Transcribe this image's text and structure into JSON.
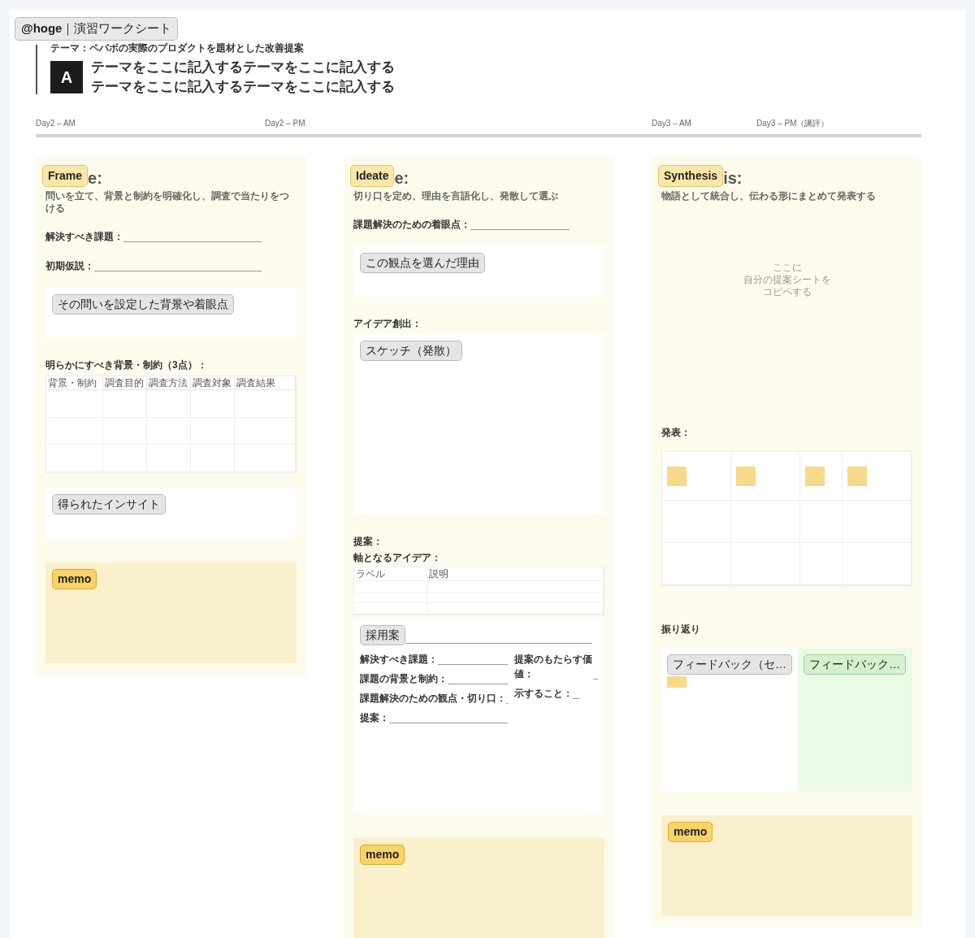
{
  "header": {
    "chip": "**@hoge**｜演習ワークシート",
    "theme": "テーマ：ペパボの実際のプロダクトを題材とした改善提案",
    "letter": "A",
    "title_lines": [
      "テーマをここに記入するテーマをここに記入する",
      "テーマをここに記入するテーマをここに記入する"
    ]
  },
  "timeline": [
    "Day2 – AM",
    "Day2 – PM",
    "Day3 – AM",
    "Day3 – PM（講評）"
  ],
  "columns": [
    {
      "tag": "Frame",
      "heading_rest": "e:",
      "subtitle": "問いを立て、背景と制約を明確化し、調査で当たりをつける",
      "blocks": [
        {
          "kind": "field",
          "label": "解決すべき課題："
        },
        {
          "kind": "field",
          "label": "初期仮説："
        },
        {
          "kind": "card",
          "label": "その問いを設定した背景や着眼点"
        },
        {
          "kind": "section",
          "label": "明らかにすべき背景・制約（3点）："
        },
        {
          "kind": "table",
          "columns": [
            "背景・制約",
            "調査目的",
            "調査方法",
            "調査対象",
            "調査結果"
          ]
        },
        {
          "kind": "card",
          "label": "得られたインサイト"
        },
        {
          "kind": "memo",
          "label": "memo"
        }
      ]
    },
    {
      "tag": "Ideate",
      "heading_rest": "e:",
      "subtitle": "切り口を定め、理由を言語化し、発散して選ぶ",
      "blocks": [
        {
          "kind": "field",
          "label": "課題解決のための着眼点："
        },
        {
          "kind": "card",
          "label": "この観点を選んだ理由"
        },
        {
          "kind": "section",
          "label": "アイデア創出："
        },
        {
          "kind": "sketch",
          "label": "スケッチ（発散）"
        },
        {
          "kind": "section",
          "label": "提案："
        },
        {
          "kind": "subsection",
          "label": "軸となるアイデア："
        },
        {
          "kind": "idea-table",
          "columns": [
            "ラベル",
            "説明"
          ]
        },
        {
          "kind": "adopted",
          "label": "採用案",
          "fields_left": [
            "解決すべき課題：",
            "課題の背景と制約：",
            "課題解決のための観点・切り口：",
            "提案："
          ],
          "fields_right": [
            "提案のもたらす価値：",
            "示すること："
          ]
        },
        {
          "kind": "memo",
          "label": "memo"
        }
      ]
    },
    {
      "tag": "Synthesis",
      "heading_rest": "is:",
      "subtitle": "物語として統合し、伝わる形にまとめて発表する",
      "blocks": [
        {
          "kind": "placeholder",
          "lines": [
            "ここに",
            "自分の提案シートを",
            "コピペする"
          ]
        },
        {
          "kind": "section",
          "label": "発表："
        },
        {
          "kind": "sticky-table"
        },
        {
          "kind": "section",
          "label": "振り返り"
        },
        {
          "kind": "feedback",
          "items": [
            {
              "label": "フィードバック（セ…",
              "color": "#e5e5e5"
            },
            {
              "label": "フィードバック…",
              "color": "#d4f0cf"
            }
          ]
        },
        {
          "kind": "memo",
          "label": "memo"
        }
      ]
    }
  ]
}
